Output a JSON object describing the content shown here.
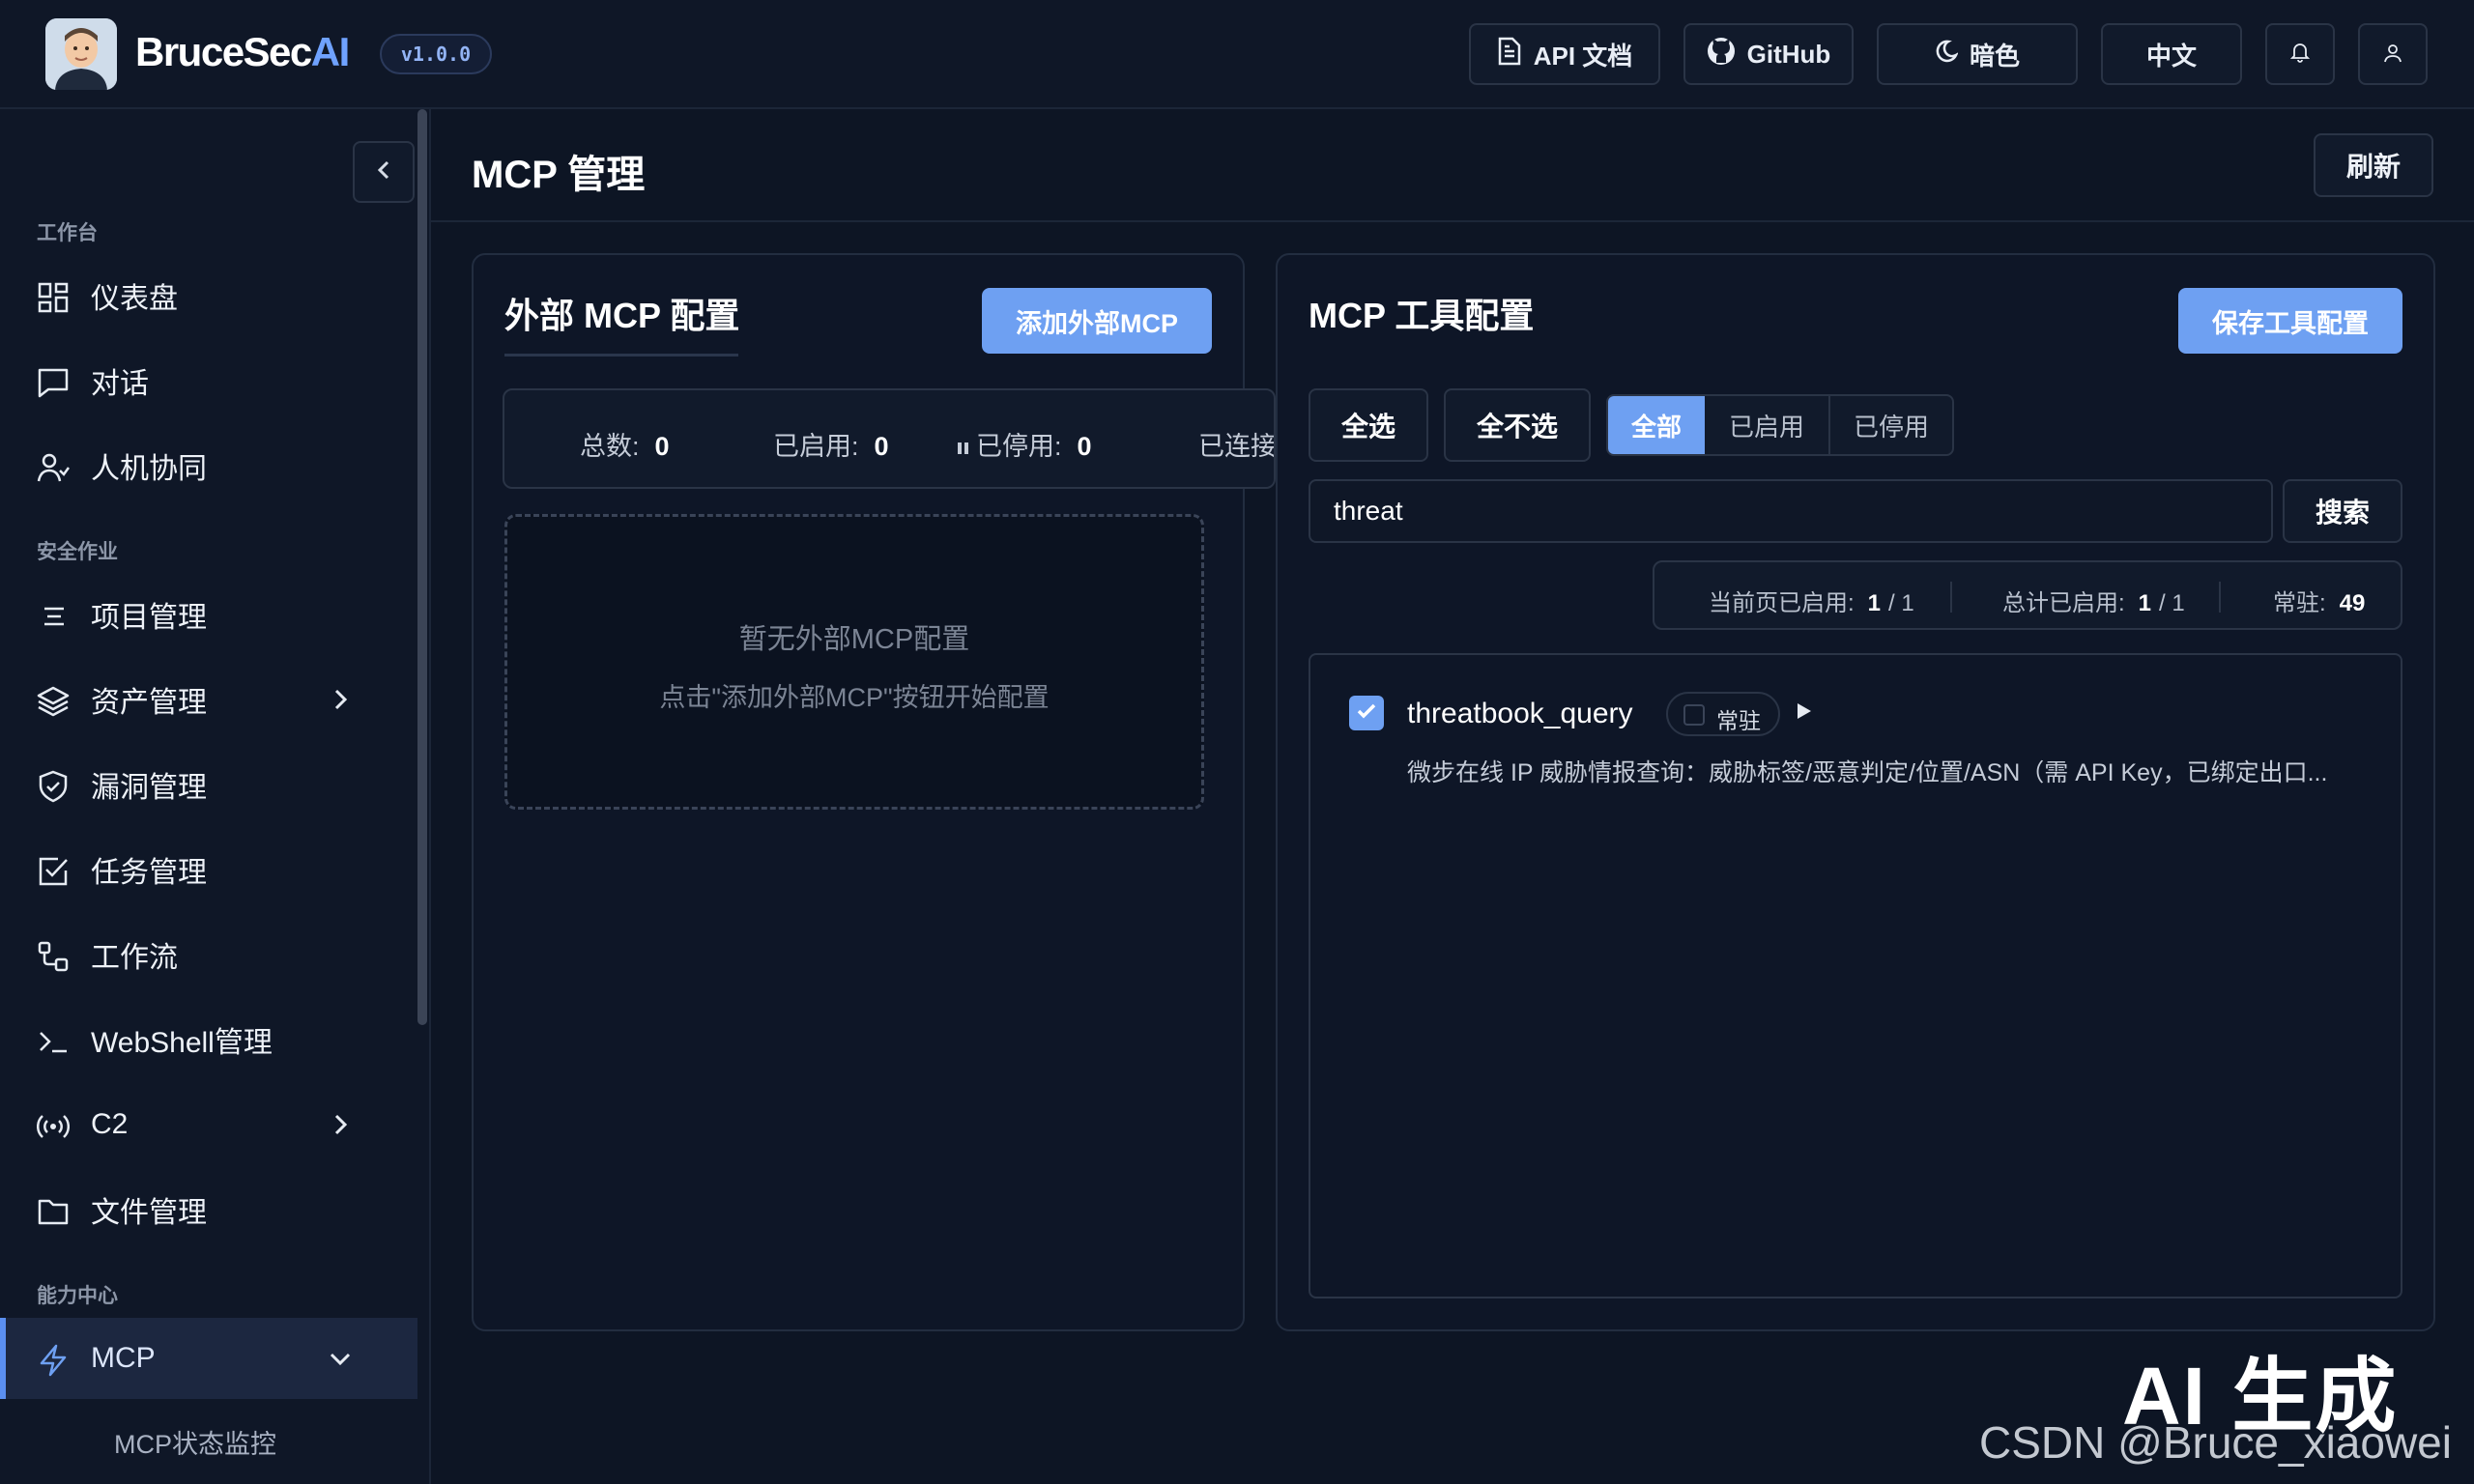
{
  "header": {
    "brand_main": "BruceSec",
    "brand_ai": "AI",
    "version": "v1.0.0",
    "api_docs_label": "API 文档",
    "github_label": "GitHub",
    "theme_label": "暗色",
    "language_label": "中文"
  },
  "sidebar": {
    "sections": {
      "workbench": "工作台",
      "security_ops": "安全作业",
      "capability_center": "能力中心"
    },
    "items": [
      {
        "label": "仪表盘",
        "icon": "dashboard-icon"
      },
      {
        "label": "对话",
        "icon": "chat-icon"
      },
      {
        "label": "人机协同",
        "icon": "user-collab-icon"
      },
      {
        "label": "项目管理",
        "icon": "list-icon"
      },
      {
        "label": "资产管理",
        "icon": "layers-icon"
      },
      {
        "label": "漏洞管理",
        "icon": "shield-icon"
      },
      {
        "label": "任务管理",
        "icon": "task-check-icon"
      },
      {
        "label": "工作流",
        "icon": "workflow-icon"
      },
      {
        "label": "WebShell管理",
        "icon": "terminal-icon"
      },
      {
        "label": "C2",
        "icon": "broadcast-icon"
      },
      {
        "label": "文件管理",
        "icon": "folder-icon"
      },
      {
        "label": "MCP",
        "icon": "lightning-icon"
      }
    ],
    "sub_item": "MCP状态监控"
  },
  "main": {
    "title": "MCP 管理",
    "refresh_label": "刷新"
  },
  "external_panel": {
    "title": "外部 MCP 配置",
    "add_button": "添加外部MCP",
    "stats": {
      "total_label": "总数:",
      "total_value": "0",
      "enabled_label": "已启用:",
      "enabled_value": "0",
      "disabled_label": "已停用:",
      "disabled_value": "0",
      "connected_label": "已连接"
    },
    "empty_title": "暂无外部MCP配置",
    "empty_hint": "点击\"添加外部MCP\"按钮开始配置"
  },
  "tools_panel": {
    "title": "MCP 工具配置",
    "save_button": "保存工具配置",
    "select_all": "全选",
    "select_none": "全不选",
    "filters": [
      "全部",
      "已启用",
      "已停用"
    ],
    "active_filter": "全部",
    "search_value": "threat",
    "search_button": "搜索",
    "counts": {
      "page_enabled_label": "当前页已启用:",
      "page_enabled": "1",
      "page_total": "/ 1",
      "total_enabled_label": "总计已启用:",
      "total_enabled": "1",
      "total_total": "/ 1",
      "resident_label": "常驻:",
      "resident_value": "49"
    },
    "tools": [
      {
        "name": "threatbook_query",
        "checked": true,
        "pin_label": "常驻",
        "description": "微步在线 IP 威胁情报查询：威胁标签/恶意判定/位置/ASN（需 API Key，已绑定出口..."
      }
    ]
  },
  "watermark": {
    "ai": "AI 生成",
    "csdn": "CSDN @Bruce_xiaowei"
  },
  "colors": {
    "accent": "#6ea0f2",
    "background": "#0d1524",
    "panel": "#0e1627"
  }
}
